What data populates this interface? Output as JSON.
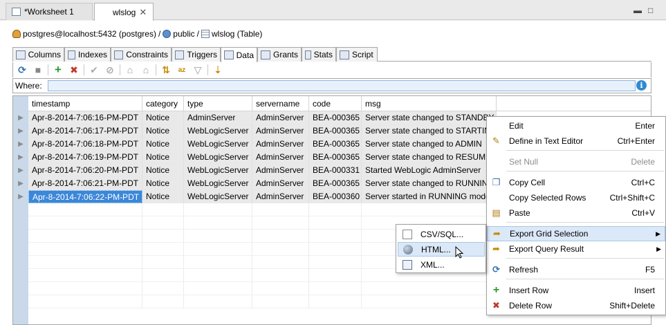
{
  "editor_tabs": [
    {
      "label": "*Worksheet 1",
      "active": false
    },
    {
      "label": "wlslog",
      "active": true
    }
  ],
  "breadcrumb": {
    "connection": "postgres@localhost:5432 (postgres)",
    "schema": "public",
    "table": "wlslog (Table)",
    "separator": "/"
  },
  "subtabs": [
    "Columns",
    "Indexes",
    "Constraints",
    "Triggers",
    "Data",
    "Grants",
    "Stats",
    "Script"
  ],
  "selected_subtab": "Data",
  "where": {
    "label": "Where:",
    "value": ""
  },
  "grid": {
    "columns": [
      "timestamp",
      "category",
      "type",
      "servername",
      "code",
      "msg"
    ],
    "rows": [
      [
        "Apr-8-2014-7:06:16-PM-PDT",
        "Notice",
        "AdminServer",
        "AdminServer",
        "BEA-000365",
        "Server state changed to STANDBY"
      ],
      [
        "Apr-8-2014-7:06:17-PM-PDT",
        "Notice",
        "WebLogicServer",
        "AdminServer",
        "BEA-000365",
        "Server state changed to STARTING"
      ],
      [
        "Apr-8-2014-7:06:18-PM-PDT",
        "Notice",
        "WebLogicServer",
        "AdminServer",
        "BEA-000365",
        "Server state changed to ADMIN"
      ],
      [
        "Apr-8-2014-7:06:19-PM-PDT",
        "Notice",
        "WebLogicServer",
        "AdminServer",
        "BEA-000365",
        "Server state changed to RESUMING"
      ],
      [
        "Apr-8-2014-7:06:20-PM-PDT",
        "Notice",
        "WebLogicServer",
        "AdminServer",
        "BEA-000331",
        "Started WebLogic AdminServer"
      ],
      [
        "Apr-8-2014-7:06:21-PM-PDT",
        "Notice",
        "WebLogicServer",
        "AdminServer",
        "BEA-000365",
        "Server state changed to RUNNING"
      ],
      [
        "Apr-8-2014-7:06:22-PM-PDT",
        "Notice",
        "WebLogicServer",
        "AdminServer",
        "BEA-000360",
        "Server started in RUNNING mode"
      ]
    ]
  },
  "context_menu": {
    "edit": {
      "label": "Edit",
      "shortcut": "Enter"
    },
    "define": {
      "label": "Define in Text Editor",
      "shortcut": "Ctrl+Enter"
    },
    "set_null": {
      "label": "Set Null",
      "shortcut": "Delete"
    },
    "copy_cell": {
      "label": "Copy Cell",
      "shortcut": "Ctrl+C"
    },
    "copy_rows": {
      "label": "Copy Selected Rows",
      "shortcut": "Ctrl+Shift+C"
    },
    "paste": {
      "label": "Paste",
      "shortcut": "Ctrl+V"
    },
    "export_grid": {
      "label": "Export Grid Selection"
    },
    "export_query": {
      "label": "Export Query Result"
    },
    "refresh": {
      "label": "Refresh",
      "shortcut": "F5"
    },
    "insert_row": {
      "label": "Insert Row",
      "shortcut": "Insert"
    },
    "delete_row": {
      "label": "Delete Row",
      "shortcut": "Shift+Delete"
    }
  },
  "submenu": {
    "csv": "CSV/SQL...",
    "html": "HTML...",
    "xml": "XML..."
  }
}
